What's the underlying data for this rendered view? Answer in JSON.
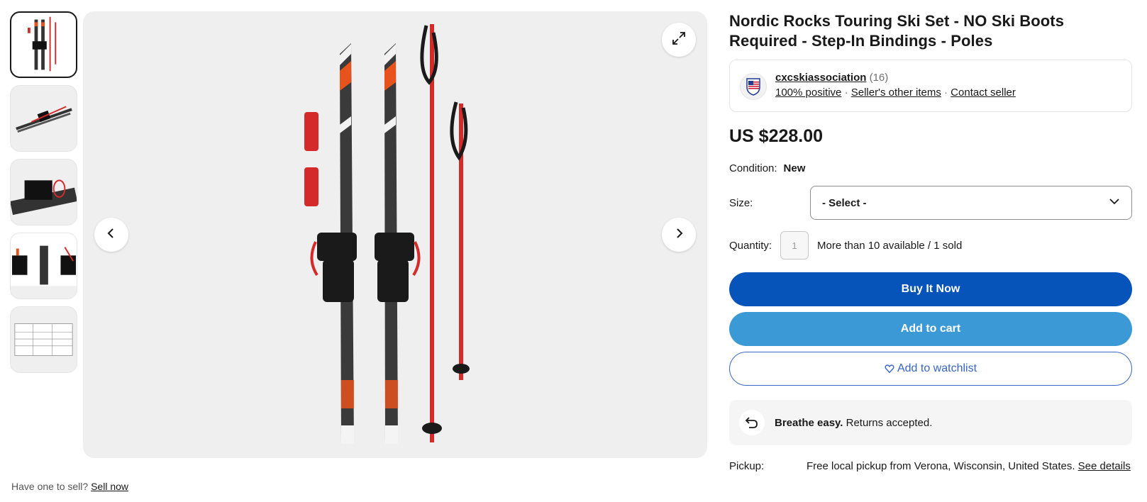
{
  "product": {
    "title": "Nordic Rocks Touring Ski Set - NO Ski Boots Required - Step-In Bindings - Poles",
    "price": "US $228.00"
  },
  "seller": {
    "name": "cxcskiassociation",
    "feedback_count": "(16)",
    "positive": "100% positive",
    "other_items": "Seller's other items",
    "contact": "Contact seller"
  },
  "condition": {
    "label": "Condition:",
    "value": "New"
  },
  "size": {
    "label": "Size:",
    "selected": "- Select -"
  },
  "quantity": {
    "label": "Quantity:",
    "value": "1",
    "availability": "More than 10 available / 1 sold"
  },
  "buttons": {
    "buy": "Buy It Now",
    "cart": "Add to cart",
    "watch": "Add to watchlist"
  },
  "returns": {
    "bold": "Breathe easy.",
    "text": " Returns accepted."
  },
  "pickup": {
    "label": "Pickup:",
    "text": "Free local pickup from Verona, Wisconsin, United States. ",
    "link": "See details"
  },
  "sell": {
    "question": "Have one to sell?",
    "link": "Sell now"
  },
  "gallery": {
    "thumbnail_count": 5,
    "active_index": 0
  },
  "colors": {
    "buy_button": "#0654ba",
    "cart_button": "#3b9ad6",
    "watch_text": "#3665c7",
    "ski_orange": "#e8531d",
    "pole_red": "#d42a2a"
  },
  "icons": {
    "prev": "chevron-left-icon",
    "next": "chevron-right-icon",
    "expand": "expand-icon",
    "dropdown": "chevron-down-icon",
    "watch": "heart-icon",
    "returns": "return-arrow-icon"
  }
}
